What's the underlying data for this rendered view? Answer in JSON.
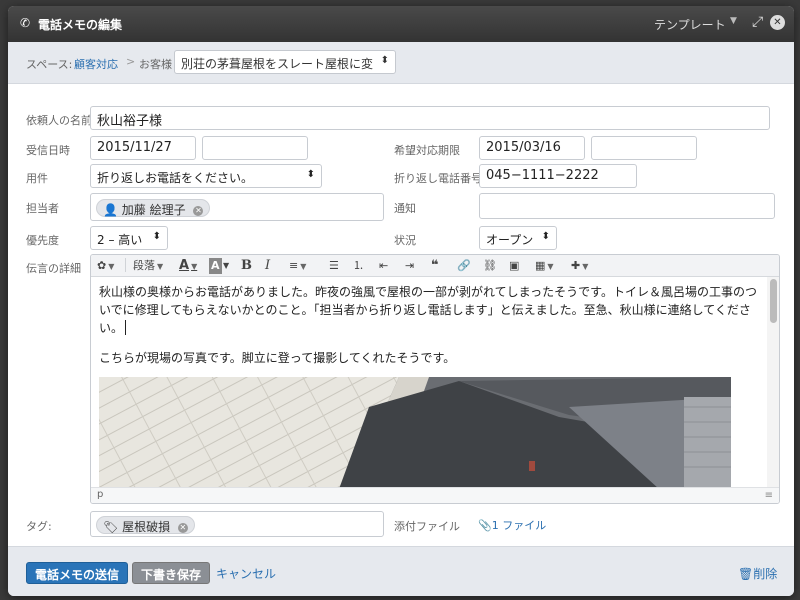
{
  "dialog": {
    "title": "電話メモの編集",
    "template_label": "テンプレート",
    "icons": {
      "phone": "phone-icon",
      "expand": "expand-icon",
      "close": "close-icon"
    }
  },
  "breadcrumb": {
    "space_label": "スペース:",
    "space_link": "顧客対応",
    "separator": ">",
    "customer_label": "お客様",
    "customer_value": "別荘の茅葺屋根をスレート屋根に変"
  },
  "form": {
    "requester_label": "依頼人の名前",
    "requester_value": "秋山裕子様",
    "received_label": "受信日時",
    "received_date": "2015/11/27",
    "received_time": "",
    "desired_label": "希望対応期限",
    "desired_date": "2015/03/16",
    "desired_time": "",
    "subject_label": "用件",
    "subject_value": "折り返しお電話をください。",
    "callback_label": "折り返し電話番号",
    "callback_value": "045−1111−2222",
    "assignee_label": "担当者",
    "assignee_chip": "加藤 絵理子",
    "notify_label": "通知",
    "notify_value": "",
    "priority_label": "優先度",
    "priority_value": "2 – 高い",
    "status_label": "状況",
    "status_value": "オープン",
    "message_label": "伝言の詳細",
    "tags_label": "タグ:",
    "tag_chip": "屋根破損",
    "attachment_label": "添付ファイル",
    "attachment_link": "1 ファイル"
  },
  "editor": {
    "toolbar": {
      "paragraph_label": "段落",
      "bold": "B",
      "italic": "I"
    },
    "paragraph1": "秋山様の奥様からお電話がありました。昨夜の強風で屋根の一部が剥がれてしまったそうです。トイレ＆風呂場の工事のついでに修理してもらえないかとのこと。「担当者から折り返し電話します」と伝えました。至急、秋山様に連絡してください。",
    "paragraph2": "こちらが現場の写真です。脚立に登って撮影してくれたそうです。",
    "status_path": "p"
  },
  "footer": {
    "send_label": "電話メモの送信",
    "draft_label": "下書き保存",
    "cancel_label": "キャンセル",
    "delete_label": "削除"
  },
  "colors": {
    "accent": "#2a74b8",
    "link": "#2a6fb0",
    "titlebar": "#3a3a3a"
  }
}
